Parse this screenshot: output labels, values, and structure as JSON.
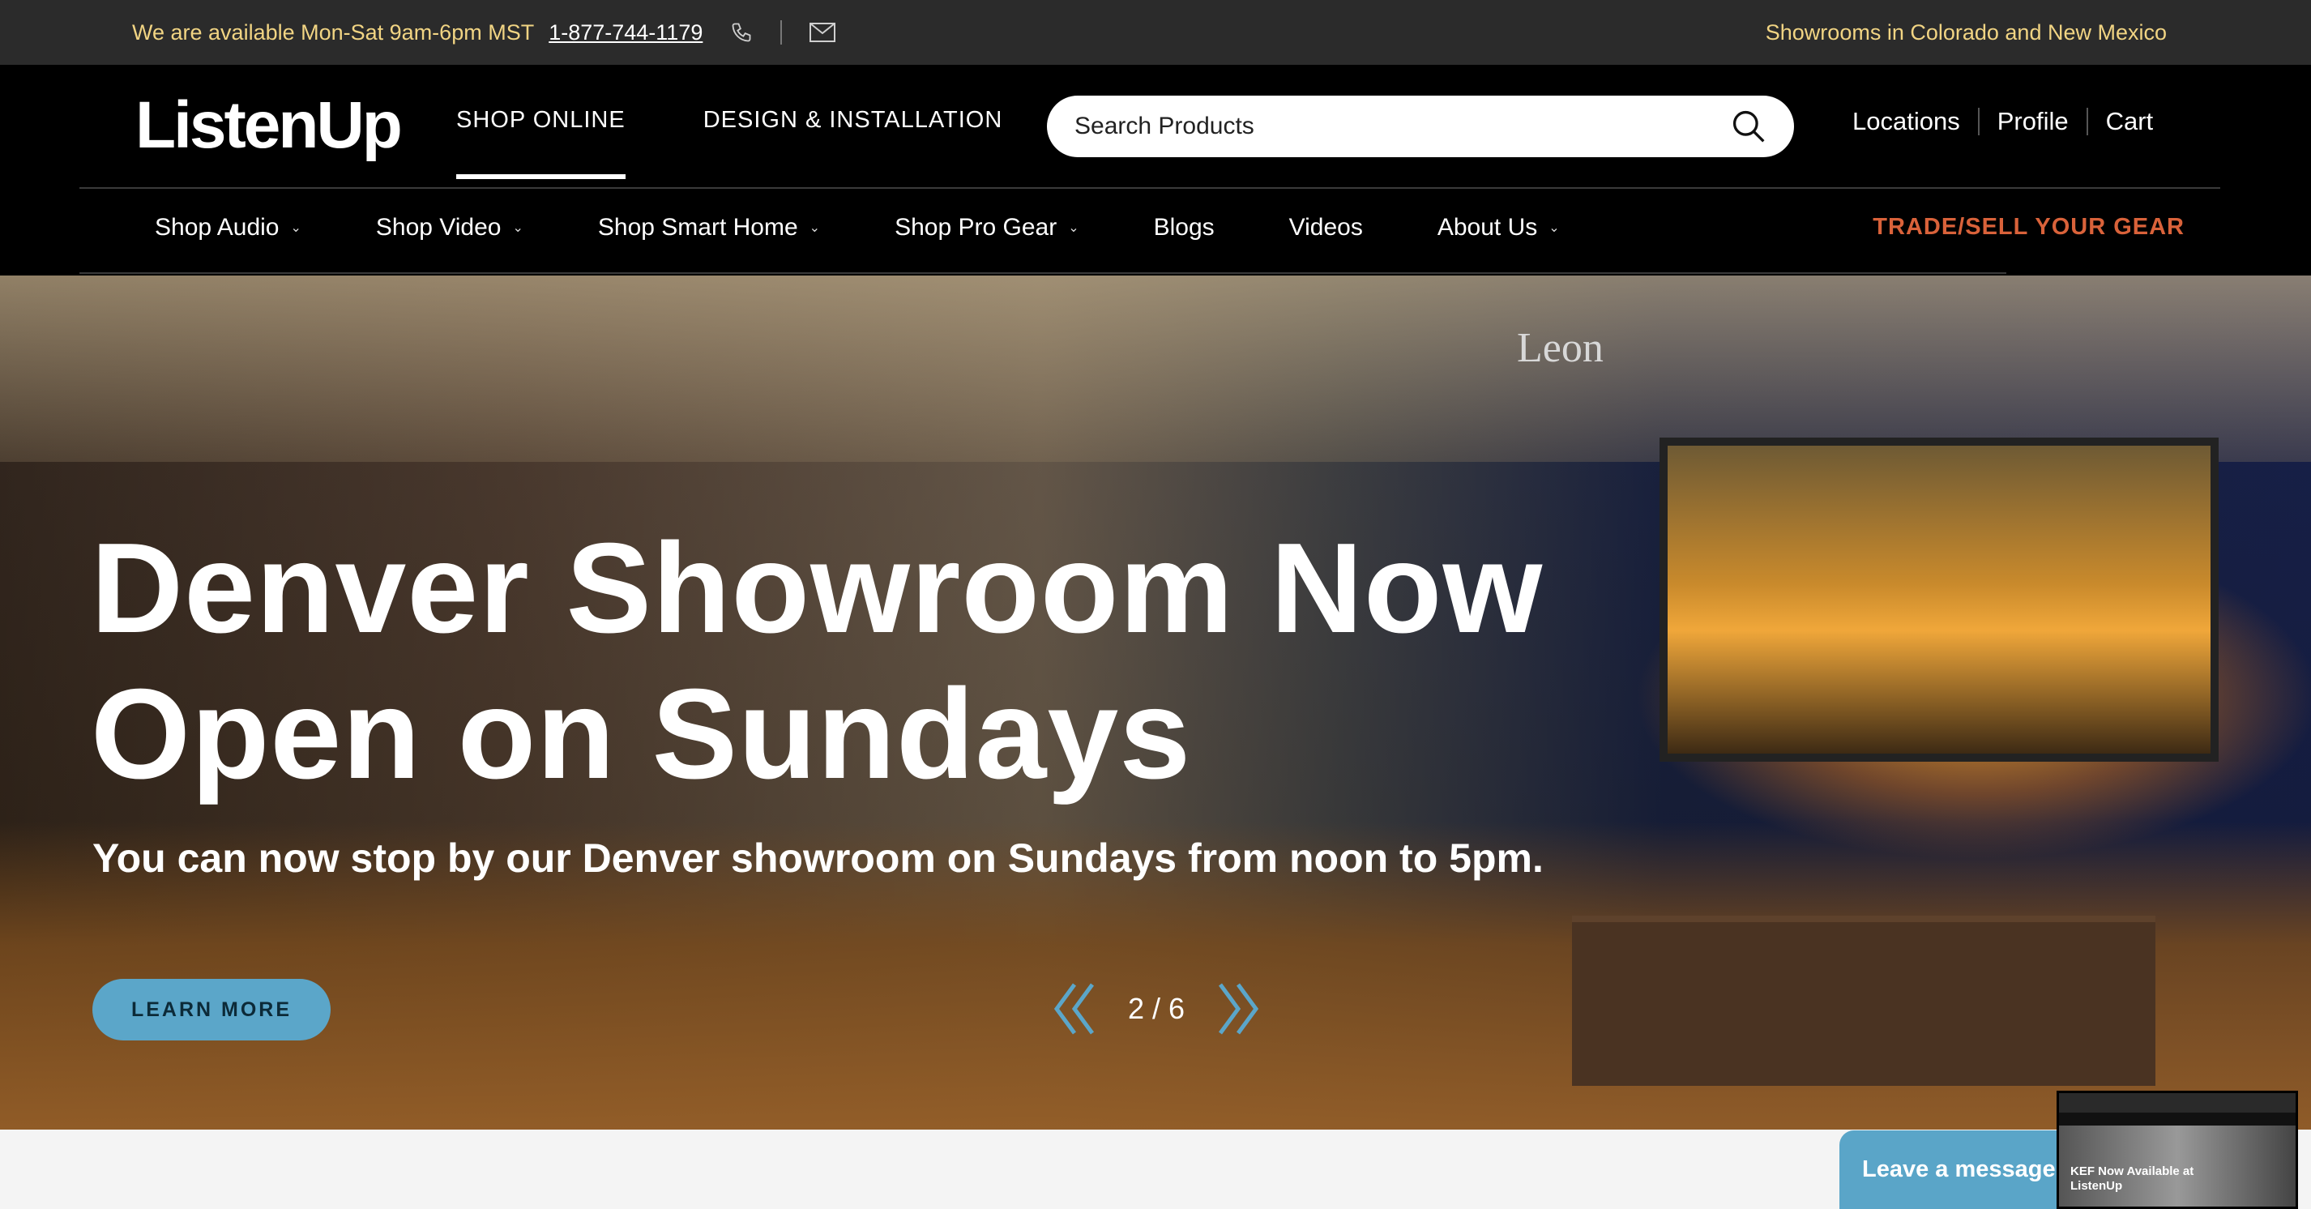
{
  "topbar": {
    "hours": "We are available Mon-Sat 9am-6pm MST",
    "phone": "1-877-744-1179",
    "showrooms": "Showrooms in Colorado and New Mexico",
    "phone_icon": "phone-icon",
    "mail_icon": "mail-icon"
  },
  "header": {
    "logo": "ListenUp",
    "nav": {
      "shop_online": "SHOP ONLINE",
      "design": "DESIGN & INSTALLATION"
    },
    "search": {
      "placeholder": "Search Products",
      "icon": "search-icon"
    },
    "util": {
      "locations": "Locations",
      "profile": "Profile",
      "cart": "Cart"
    }
  },
  "subnav": {
    "items": [
      "Shop Audio",
      "Shop Video",
      "Shop Smart Home",
      "Shop Pro Gear",
      "Blogs",
      "Videos",
      "About Us"
    ],
    "trade": "TRADE/SELL YOUR GEAR"
  },
  "hero": {
    "headline_line1": "Denver Showroom Now",
    "headline_line2": "Open on Sundays",
    "subhead": "You can now stop by our Denver showroom on Sundays from noon to 5pm.",
    "cta": "LEARN MORE",
    "pager": "2 / 6",
    "brand_sign": "Leon"
  },
  "chat": {
    "leave_message": "Leave a message",
    "thumb_title": "KEF Now Available at ListenUp"
  },
  "colors": {
    "accent_blue": "#5ba6c9",
    "trade_orange": "#d9623a",
    "topbar_gold": "#f1d483"
  }
}
